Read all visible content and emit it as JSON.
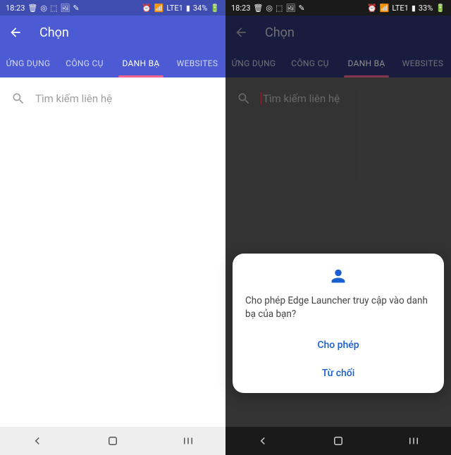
{
  "left": {
    "status": {
      "time": "18:23",
      "battery": "34%",
      "net": "LTE1"
    },
    "appbar": {
      "title": "Chọn"
    },
    "tabs": [
      "ỨNG DỤNG",
      "CÔNG CỤ",
      "DANH BẠ",
      "WEBSITES"
    ],
    "activeTab": 2,
    "search": {
      "placeholder": "Tìm kiếm liên hệ"
    }
  },
  "right": {
    "status": {
      "time": "18:23",
      "battery": "33%",
      "net": "LTE1"
    },
    "appbar": {
      "title": "Chọn"
    },
    "tabs": [
      "ỨNG DỤNG",
      "CÔNG CỤ",
      "DANH BẠ",
      "WEBSITES"
    ],
    "activeTab": 2,
    "search": {
      "placeholder": "Tìm kiếm liên hệ"
    },
    "dialog": {
      "message": "Cho phép Edge Launcher truy cập vào danh bạ của bạn?",
      "allow": "Cho phép",
      "deny": "Từ chối"
    }
  }
}
